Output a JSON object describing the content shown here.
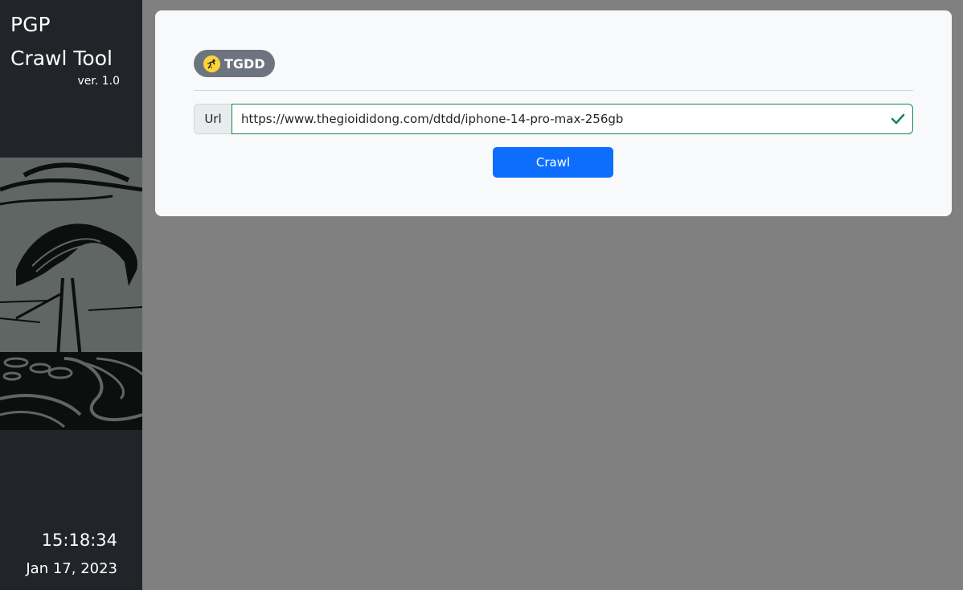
{
  "sidebar": {
    "brand_title": "PGP\nCrawl Tool",
    "version": "ver. 1.0",
    "artwork_icon": "heron-linocut-image",
    "clock": "15:18:34",
    "date": "Jan 17, 2023"
  },
  "main": {
    "source_tag": {
      "label": "TGDD",
      "icon": "tgdd-logo-icon"
    },
    "url_field": {
      "prefix_label": "Url",
      "value": "https://www.thegioididong.com/dtdd/iphone-14-pro-max-256gb",
      "valid_icon": "checkmark-icon"
    },
    "crawl_button_label": "Crawl"
  },
  "colors": {
    "sidebar_bg": "#212529",
    "page_bg": "#808080",
    "card_bg": "#f8f9fa",
    "tag_bg": "#6c757d",
    "primary": "#0d6efd",
    "valid": "#198754"
  }
}
